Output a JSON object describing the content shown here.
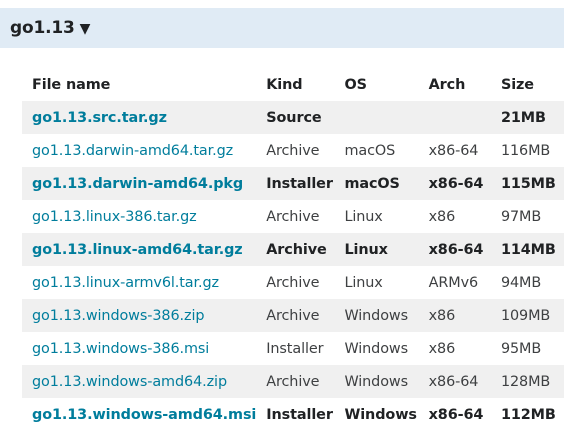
{
  "release": {
    "title": "go1.13",
    "toggle_glyph": "▼"
  },
  "table": {
    "headers": {
      "filename": "File name",
      "kind": "Kind",
      "os": "OS",
      "arch": "Arch",
      "size": "Size"
    },
    "rows": [
      {
        "filename": "go1.13.src.tar.gz",
        "kind": "Source",
        "os": "",
        "arch": "",
        "size": "21MB",
        "featured": true
      },
      {
        "filename": "go1.13.darwin-amd64.tar.gz",
        "kind": "Archive",
        "os": "macOS",
        "arch": "x86-64",
        "size": "116MB",
        "featured": false
      },
      {
        "filename": "go1.13.darwin-amd64.pkg",
        "kind": "Installer",
        "os": "macOS",
        "arch": "x86-64",
        "size": "115MB",
        "featured": true
      },
      {
        "filename": "go1.13.linux-386.tar.gz",
        "kind": "Archive",
        "os": "Linux",
        "arch": "x86",
        "size": "97MB",
        "featured": false
      },
      {
        "filename": "go1.13.linux-amd64.tar.gz",
        "kind": "Archive",
        "os": "Linux",
        "arch": "x86-64",
        "size": "114MB",
        "featured": true
      },
      {
        "filename": "go1.13.linux-armv6l.tar.gz",
        "kind": "Archive",
        "os": "Linux",
        "arch": "ARMv6",
        "size": "94MB",
        "featured": false
      },
      {
        "filename": "go1.13.windows-386.zip",
        "kind": "Archive",
        "os": "Windows",
        "arch": "x86",
        "size": "109MB",
        "featured": false
      },
      {
        "filename": "go1.13.windows-386.msi",
        "kind": "Installer",
        "os": "Windows",
        "arch": "x86",
        "size": "95MB",
        "featured": false
      },
      {
        "filename": "go1.13.windows-amd64.zip",
        "kind": "Archive",
        "os": "Windows",
        "arch": "x86-64",
        "size": "128MB",
        "featured": false
      },
      {
        "filename": "go1.13.windows-amd64.msi",
        "kind": "Installer",
        "os": "Windows",
        "arch": "x86-64",
        "size": "112MB",
        "featured": true
      }
    ]
  },
  "colors": {
    "header_bg": "#e0ebf5",
    "link": "#007d9c",
    "zebra_row": "#f0f0f0"
  }
}
